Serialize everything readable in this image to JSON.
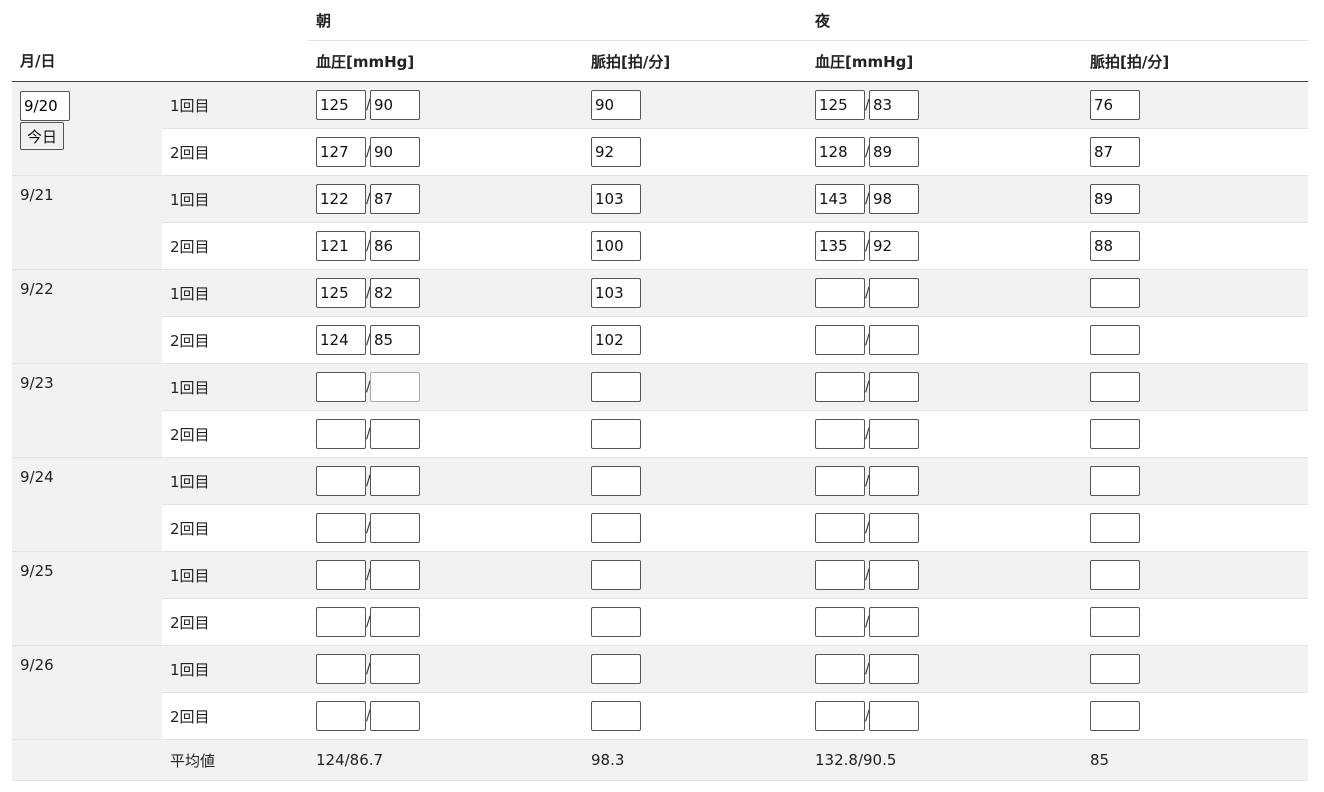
{
  "header": {
    "date_col": "月/日",
    "morning_group": "朝",
    "evening_group": "夜",
    "bp_label": "血圧[mmHg]",
    "pulse_label": "脈拍[拍/分]"
  },
  "today_button": "今日",
  "rounds": [
    "1回目",
    "2回目"
  ],
  "days": [
    {
      "date": "9/20",
      "entries": [
        {
          "m_sys": "125",
          "m_dia": "90",
          "m_pulse": "90",
          "e_sys": "125",
          "e_dia": "83",
          "e_pulse": "76"
        },
        {
          "m_sys": "127",
          "m_dia": "90",
          "m_pulse": "92",
          "e_sys": "128",
          "e_dia": "89",
          "e_pulse": "87"
        }
      ]
    },
    {
      "date": "9/21",
      "entries": [
        {
          "m_sys": "122",
          "m_dia": "87",
          "m_pulse": "103",
          "e_sys": "143",
          "e_dia": "98",
          "e_pulse": "89"
        },
        {
          "m_sys": "121",
          "m_dia": "86",
          "m_pulse": "100",
          "e_sys": "135",
          "e_dia": "92",
          "e_pulse": "88"
        }
      ]
    },
    {
      "date": "9/22",
      "entries": [
        {
          "m_sys": "125",
          "m_dia": "82",
          "m_pulse": "103",
          "e_sys": "",
          "e_dia": "",
          "e_pulse": ""
        },
        {
          "m_sys": "124",
          "m_dia": "85",
          "m_pulse": "102",
          "e_sys": "",
          "e_dia": "",
          "e_pulse": ""
        }
      ]
    },
    {
      "date": "9/23",
      "entries": [
        {
          "m_sys": "",
          "m_dia": "",
          "m_pulse": "",
          "e_sys": "",
          "e_dia": "",
          "e_pulse": ""
        },
        {
          "m_sys": "",
          "m_dia": "",
          "m_pulse": "",
          "e_sys": "",
          "e_dia": "",
          "e_pulse": ""
        }
      ]
    },
    {
      "date": "9/24",
      "entries": [
        {
          "m_sys": "",
          "m_dia": "",
          "m_pulse": "",
          "e_sys": "",
          "e_dia": "",
          "e_pulse": ""
        },
        {
          "m_sys": "",
          "m_dia": "",
          "m_pulse": "",
          "e_sys": "",
          "e_dia": "",
          "e_pulse": ""
        }
      ]
    },
    {
      "date": "9/25",
      "entries": [
        {
          "m_sys": "",
          "m_dia": "",
          "m_pulse": "",
          "e_sys": "",
          "e_dia": "",
          "e_pulse": ""
        },
        {
          "m_sys": "",
          "m_dia": "",
          "m_pulse": "",
          "e_sys": "",
          "e_dia": "",
          "e_pulse": ""
        }
      ]
    },
    {
      "date": "9/26",
      "entries": [
        {
          "m_sys": "",
          "m_dia": "",
          "m_pulse": "",
          "e_sys": "",
          "e_dia": "",
          "e_pulse": ""
        },
        {
          "m_sys": "",
          "m_dia": "",
          "m_pulse": "",
          "e_sys": "",
          "e_dia": "",
          "e_pulse": ""
        }
      ]
    }
  ],
  "average": {
    "label": "平均値",
    "morning_bp": "124/86.7",
    "morning_pulse": "98.3",
    "evening_bp": "132.8/90.5",
    "evening_pulse": "85"
  }
}
